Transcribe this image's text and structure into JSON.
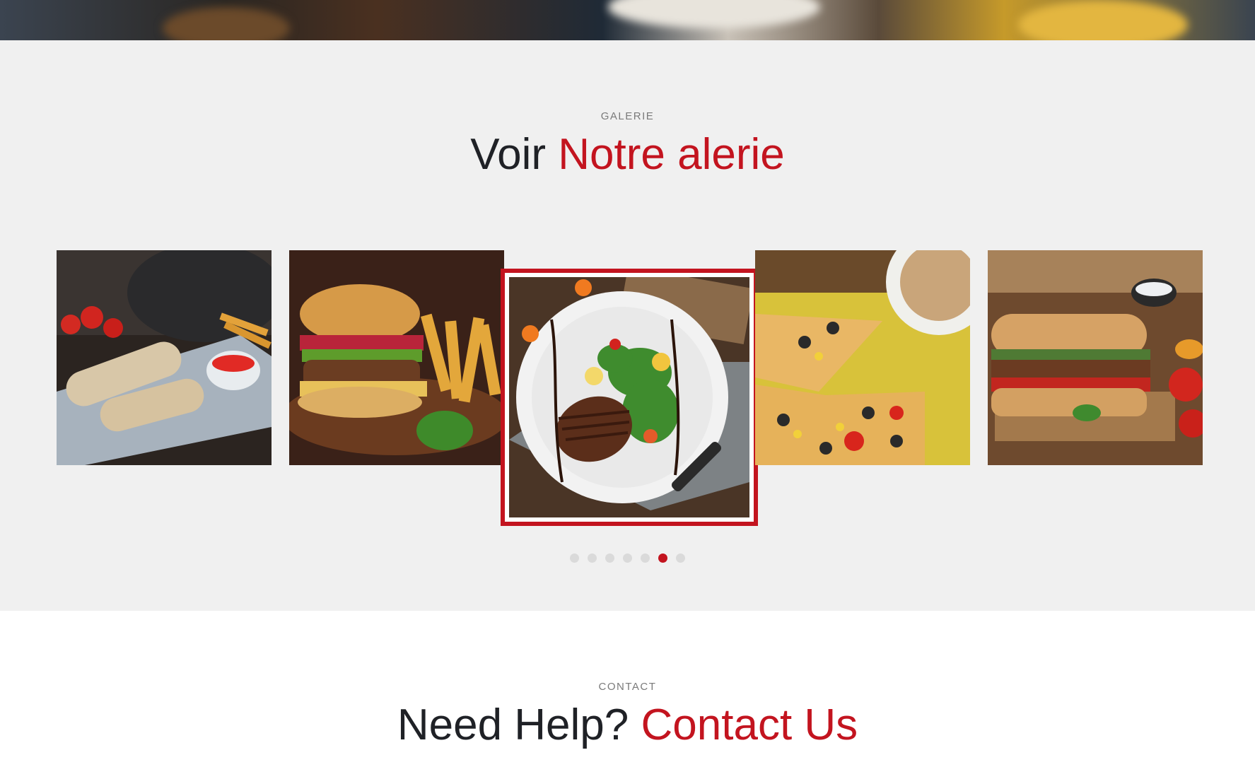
{
  "gallery": {
    "eyebrow": "GALERIE",
    "title_plain": "Voir ",
    "title_accent": "Notre alerie",
    "slides": [
      {
        "name": "Wrap plate"
      },
      {
        "name": "Burger with fries"
      },
      {
        "name": "Steak salad plate"
      },
      {
        "name": "Pizza"
      },
      {
        "name": "Sandwich on board"
      }
    ],
    "dots": [
      false,
      false,
      false,
      false,
      false,
      true,
      false
    ],
    "active_dot_index": 5
  },
  "contact": {
    "eyebrow": "CONTACT",
    "title_plain": "Need Help? ",
    "title_accent": "Contact Us"
  },
  "colors": {
    "accent": "#c3141f",
    "gallery_bg": "#f0f0f0",
    "dot_inactive": "#dadada",
    "heading": "#1f2126"
  }
}
